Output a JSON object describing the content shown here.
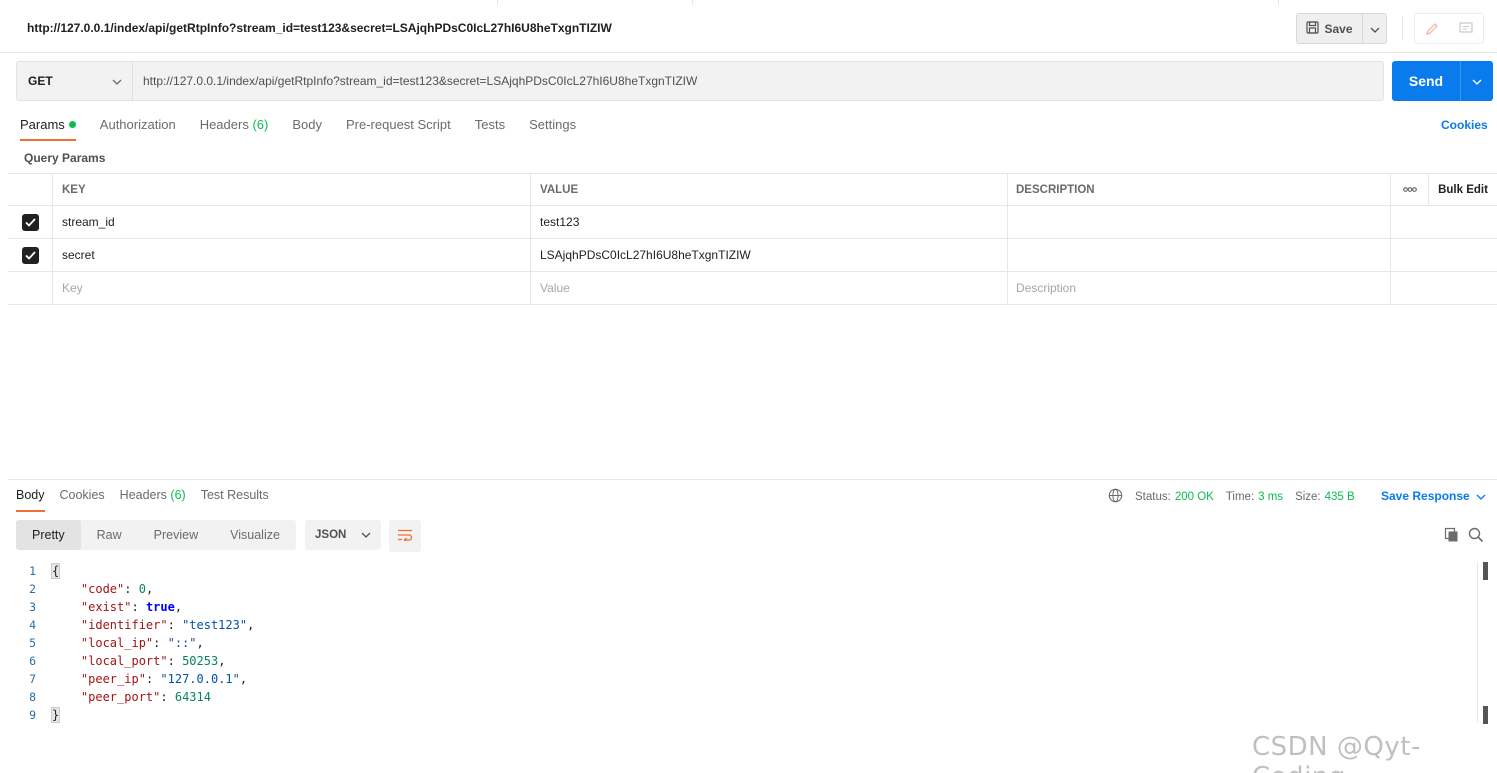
{
  "window": {
    "title_url": "http://127.0.0.1/index/api/getRtpInfo?stream_id=test123&secret=LSAjqhPDsC0IcL27hI6U8heTxgnTIZIW",
    "save_label": "Save"
  },
  "request": {
    "method": "GET",
    "url": "http://127.0.0.1/index/api/getRtpInfo?stream_id=test123&secret=LSAjqhPDsC0IcL27hI6U8heTxgnTIZIW",
    "send_label": "Send"
  },
  "request_tabs": [
    {
      "label": "Params"
    },
    {
      "label": "Authorization"
    },
    {
      "label": "Headers",
      "count": "(6)"
    },
    {
      "label": "Body"
    },
    {
      "label": "Pre-request Script"
    },
    {
      "label": "Tests"
    },
    {
      "label": "Settings"
    }
  ],
  "cookies_label": "Cookies",
  "query_params": {
    "title": "Query Params",
    "headers": {
      "key": "KEY",
      "value": "VALUE",
      "description": "DESCRIPTION",
      "more": "ooo",
      "bulk_edit": "Bulk Edit"
    },
    "rows": [
      {
        "checked": true,
        "key": "stream_id",
        "value": "test123",
        "description": ""
      },
      {
        "checked": true,
        "key": "secret",
        "value": "LSAjqhPDsC0IcL27hI6U8heTxgnTIZIW",
        "description": ""
      }
    ],
    "placeholders": {
      "key": "Key",
      "value": "Value",
      "description": "Description"
    }
  },
  "response": {
    "tabs": [
      {
        "label": "Body"
      },
      {
        "label": "Cookies"
      },
      {
        "label": "Headers",
        "count": "(6)"
      },
      {
        "label": "Test Results"
      }
    ],
    "status_label": "Status:",
    "status_value": "200 OK",
    "time_label": "Time:",
    "time_value": "3 ms",
    "size_label": "Size:",
    "size_value": "435 B",
    "save_response_label": "Save Response",
    "view_tabs": [
      "Pretty",
      "Raw",
      "Preview",
      "Visualize"
    ],
    "format": "JSON",
    "code_lines": [
      {
        "n": "1",
        "open": "{"
      },
      {
        "n": "2",
        "key": "\"code\"",
        "val": "0",
        "type": "n",
        "comma": ","
      },
      {
        "n": "3",
        "key": "\"exist\"",
        "val": "true",
        "type": "b",
        "comma": ","
      },
      {
        "n": "4",
        "key": "\"identifier\"",
        "val": "\"test123\"",
        "type": "s",
        "comma": ","
      },
      {
        "n": "5",
        "key": "\"local_ip\"",
        "val": "\"::\"",
        "type": "s",
        "comma": ","
      },
      {
        "n": "6",
        "key": "\"local_port\"",
        "val": "50253",
        "type": "n",
        "comma": ","
      },
      {
        "n": "7",
        "key": "\"peer_ip\"",
        "val": "\"127.0.0.1\"",
        "type": "s",
        "comma": ","
      },
      {
        "n": "8",
        "key": "\"peer_port\"",
        "val": "64314",
        "type": "n",
        "comma": ""
      },
      {
        "n": "9",
        "open": "}"
      }
    ]
  },
  "watermark": "CSDN @Qyt-Coding",
  "colors": {
    "accent_orange": "#f26b3a",
    "send_blue": "#097bed",
    "ok_green": "#0cbb52"
  }
}
